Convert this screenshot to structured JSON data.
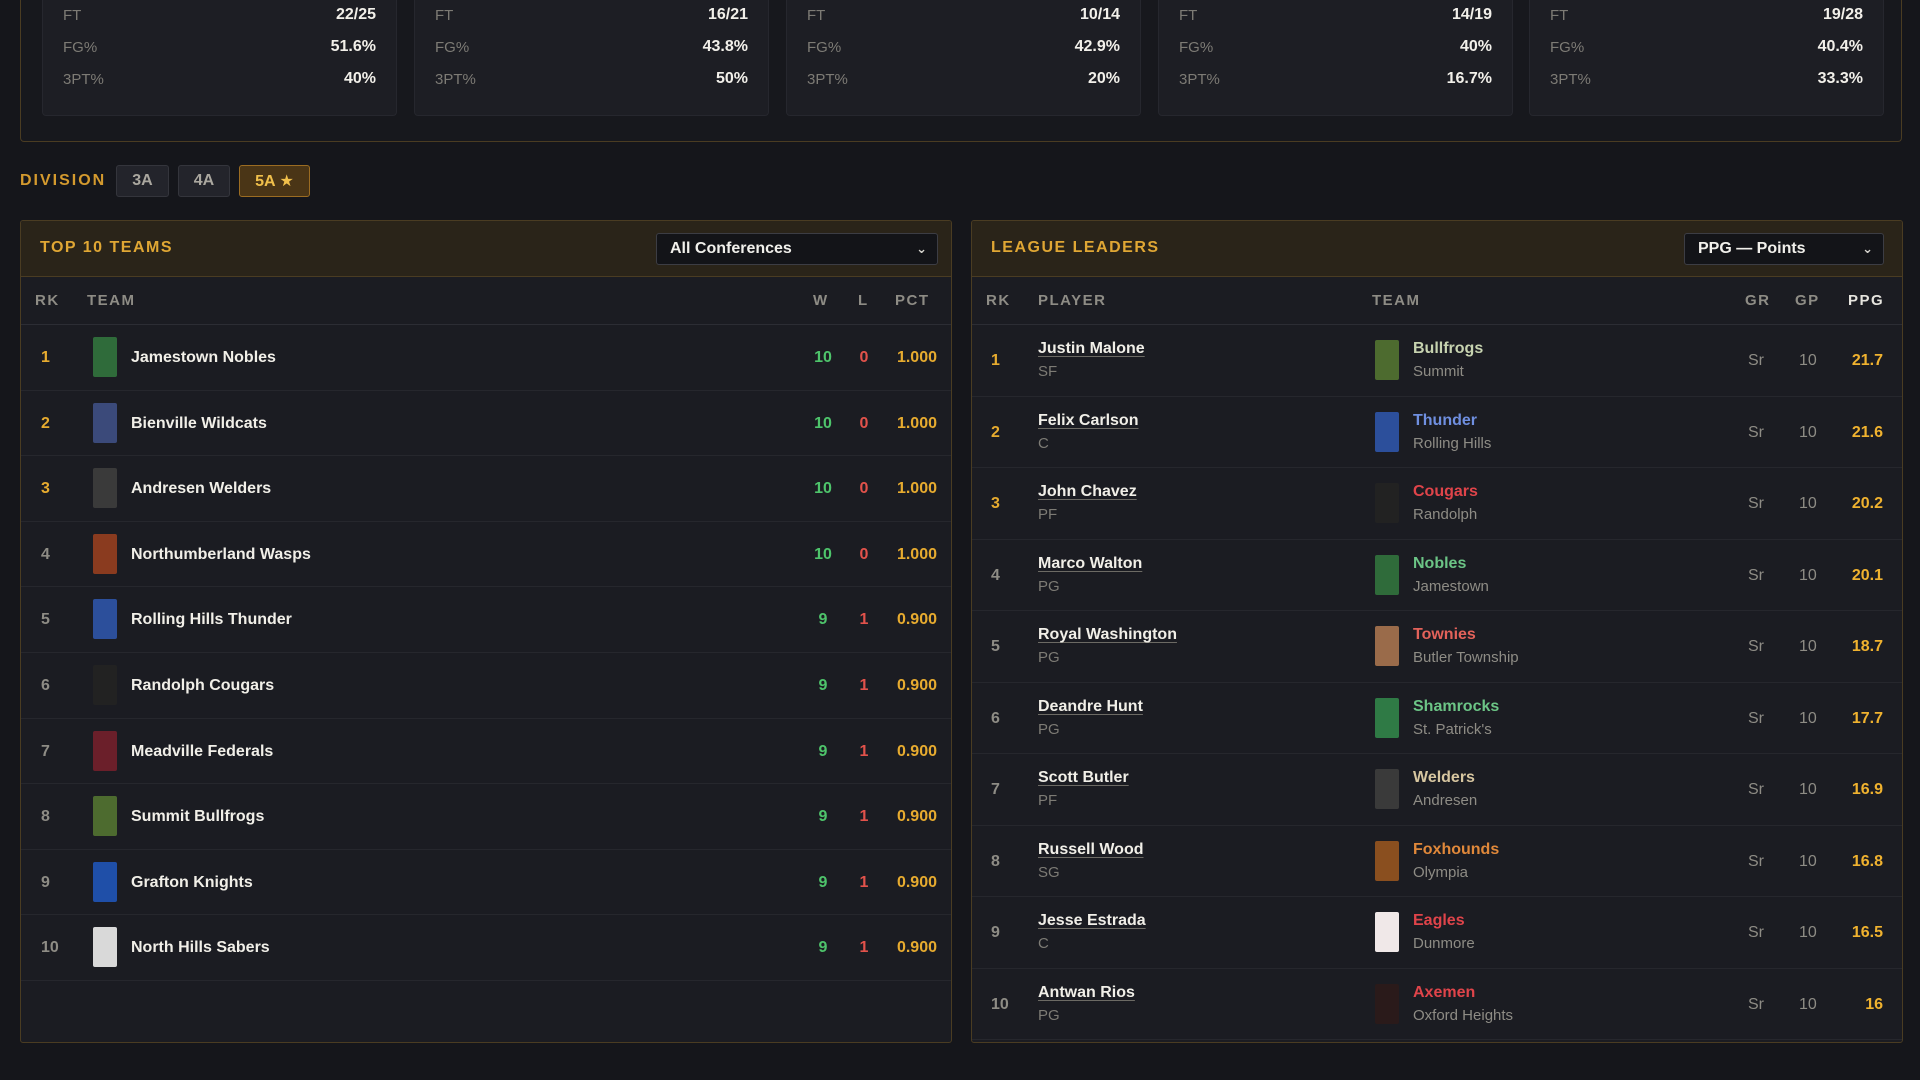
{
  "stat_cards": [
    {
      "rows": [
        {
          "label": "FT",
          "value": "22/25"
        },
        {
          "label": "FG%",
          "value": "51.6%"
        },
        {
          "label": "3PT%",
          "value": "40%"
        }
      ]
    },
    {
      "rows": [
        {
          "label": "FT",
          "value": "16/21"
        },
        {
          "label": "FG%",
          "value": "43.8%"
        },
        {
          "label": "3PT%",
          "value": "50%"
        }
      ]
    },
    {
      "rows": [
        {
          "label": "FT",
          "value": "10/14"
        },
        {
          "label": "FG%",
          "value": "42.9%"
        },
        {
          "label": "3PT%",
          "value": "20%"
        }
      ]
    },
    {
      "rows": [
        {
          "label": "FT",
          "value": "14/19"
        },
        {
          "label": "FG%",
          "value": "40%"
        },
        {
          "label": "3PT%",
          "value": "16.7%"
        }
      ]
    },
    {
      "rows": [
        {
          "label": "FT",
          "value": "19/28"
        },
        {
          "label": "FG%",
          "value": "40.4%"
        },
        {
          "label": "3PT%",
          "value": "33.3%"
        }
      ]
    }
  ],
  "division": {
    "title": "DIVISION",
    "options": [
      "3A",
      "4A",
      "5A ★"
    ],
    "selected_index": 2
  },
  "teams_panel": {
    "title": "TOP 10 TEAMS",
    "filter_value": "All Conferences",
    "chevron_icon": "chevron-down-icon",
    "columns": {
      "rk": "RK",
      "team": "TEAM",
      "w": "W",
      "l": "L",
      "pct": "PCT"
    },
    "rows": [
      {
        "rk": "1",
        "team": "Jamestown Nobles",
        "w": "10",
        "l": "0",
        "pct": "1.000",
        "logo_color": "#2f6b3a"
      },
      {
        "rk": "2",
        "team": "Bienville Wildcats",
        "w": "10",
        "l": "0",
        "pct": "1.000",
        "logo_color": "#3b4a7a"
      },
      {
        "rk": "3",
        "team": "Andresen Welders",
        "w": "10",
        "l": "0",
        "pct": "1.000",
        "logo_color": "#3a3a3a"
      },
      {
        "rk": "4",
        "team": "Northumberland Wasps",
        "w": "10",
        "l": "0",
        "pct": "1.000",
        "logo_color": "#8a3b1f"
      },
      {
        "rk": "5",
        "team": "Rolling Hills Thunder",
        "w": "9",
        "l": "1",
        "pct": "0.900",
        "logo_color": "#2c4f9b"
      },
      {
        "rk": "6",
        "team": "Randolph Cougars",
        "w": "9",
        "l": "1",
        "pct": "0.900",
        "logo_color": "#222222"
      },
      {
        "rk": "7",
        "team": "Meadville Federals",
        "w": "9",
        "l": "1",
        "pct": "0.900",
        "logo_color": "#6b1f2a"
      },
      {
        "rk": "8",
        "team": "Summit Bullfrogs",
        "w": "9",
        "l": "1",
        "pct": "0.900",
        "logo_color": "#4d6b2f"
      },
      {
        "rk": "9",
        "team": "Grafton Knights",
        "w": "9",
        "l": "1",
        "pct": "0.900",
        "logo_color": "#1f4fa8"
      },
      {
        "rk": "10",
        "team": "North Hills Sabers",
        "w": "9",
        "l": "1",
        "pct": "0.900",
        "logo_color": "#d9d9d9"
      }
    ]
  },
  "leaders_panel": {
    "title": "LEAGUE LEADERS",
    "filter_value": "PPG — Points",
    "chevron_icon": "chevron-down-icon",
    "columns": {
      "rk": "RK",
      "player": "PLAYER",
      "team": "TEAM",
      "gr": "GR",
      "gp": "GP",
      "ppg": "PPG"
    },
    "rows": [
      {
        "rk": "1",
        "player": "Justin Malone",
        "pos": "SF",
        "team": "Bullfrogs",
        "city": "Summit",
        "gr": "Sr",
        "gp": "10",
        "ppg": "21.7",
        "team_color": "#c7d3b0",
        "logo_color": "#4d6b2f"
      },
      {
        "rk": "2",
        "player": "Felix Carlson",
        "pos": "C",
        "team": "Thunder",
        "city": "Rolling Hills",
        "gr": "Sr",
        "gp": "10",
        "ppg": "21.6",
        "team_color": "#6f8fe0",
        "logo_color": "#2c4f9b"
      },
      {
        "rk": "3",
        "player": "John Chavez",
        "pos": "PF",
        "team": "Cougars",
        "city": "Randolph",
        "gr": "Sr",
        "gp": "10",
        "ppg": "20.2",
        "team_color": "#e0444a",
        "logo_color": "#222222"
      },
      {
        "rk": "4",
        "player": "Marco Walton",
        "pos": "PG",
        "team": "Nobles",
        "city": "Jamestown",
        "gr": "Sr",
        "gp": "10",
        "ppg": "20.1",
        "team_color": "#6cc586",
        "logo_color": "#2f6b3a"
      },
      {
        "rk": "5",
        "player": "Royal Washington",
        "pos": "PG",
        "team": "Townies",
        "city": "Butler Township",
        "gr": "Sr",
        "gp": "10",
        "ppg": "18.7",
        "team_color": "#e3625a",
        "logo_color": "#9a6b4a"
      },
      {
        "rk": "6",
        "player": "Deandre Hunt",
        "pos": "PG",
        "team": "Shamrocks",
        "city": "St. Patrick's",
        "gr": "Sr",
        "gp": "10",
        "ppg": "17.7",
        "team_color": "#6cc586",
        "logo_color": "#2f7a45"
      },
      {
        "rk": "7",
        "player": "Scott Butler",
        "pos": "PF",
        "team": "Welders",
        "city": "Andresen",
        "gr": "Sr",
        "gp": "10",
        "ppg": "16.9",
        "team_color": "#d7c6a0",
        "logo_color": "#3a3a3a"
      },
      {
        "rk": "8",
        "player": "Russell Wood",
        "pos": "SG",
        "team": "Foxhounds",
        "city": "Olympia",
        "gr": "Sr",
        "gp": "10",
        "ppg": "16.8",
        "team_color": "#e0883a",
        "logo_color": "#8a4f1f"
      },
      {
        "rk": "9",
        "player": "Jesse Estrada",
        "pos": "C",
        "team": "Eagles",
        "city": "Dunmore",
        "gr": "Sr",
        "gp": "10",
        "ppg": "16.5",
        "team_color": "#e0444a",
        "logo_color": "#f0e8e8"
      },
      {
        "rk": "10",
        "player": "Antwan Rios",
        "pos": "PG",
        "team": "Axemen",
        "city": "Oxford Heights",
        "gr": "Sr",
        "gp": "10",
        "ppg": "16",
        "team_color": "#e0444a",
        "logo_color": "#2a1a1a"
      }
    ]
  }
}
